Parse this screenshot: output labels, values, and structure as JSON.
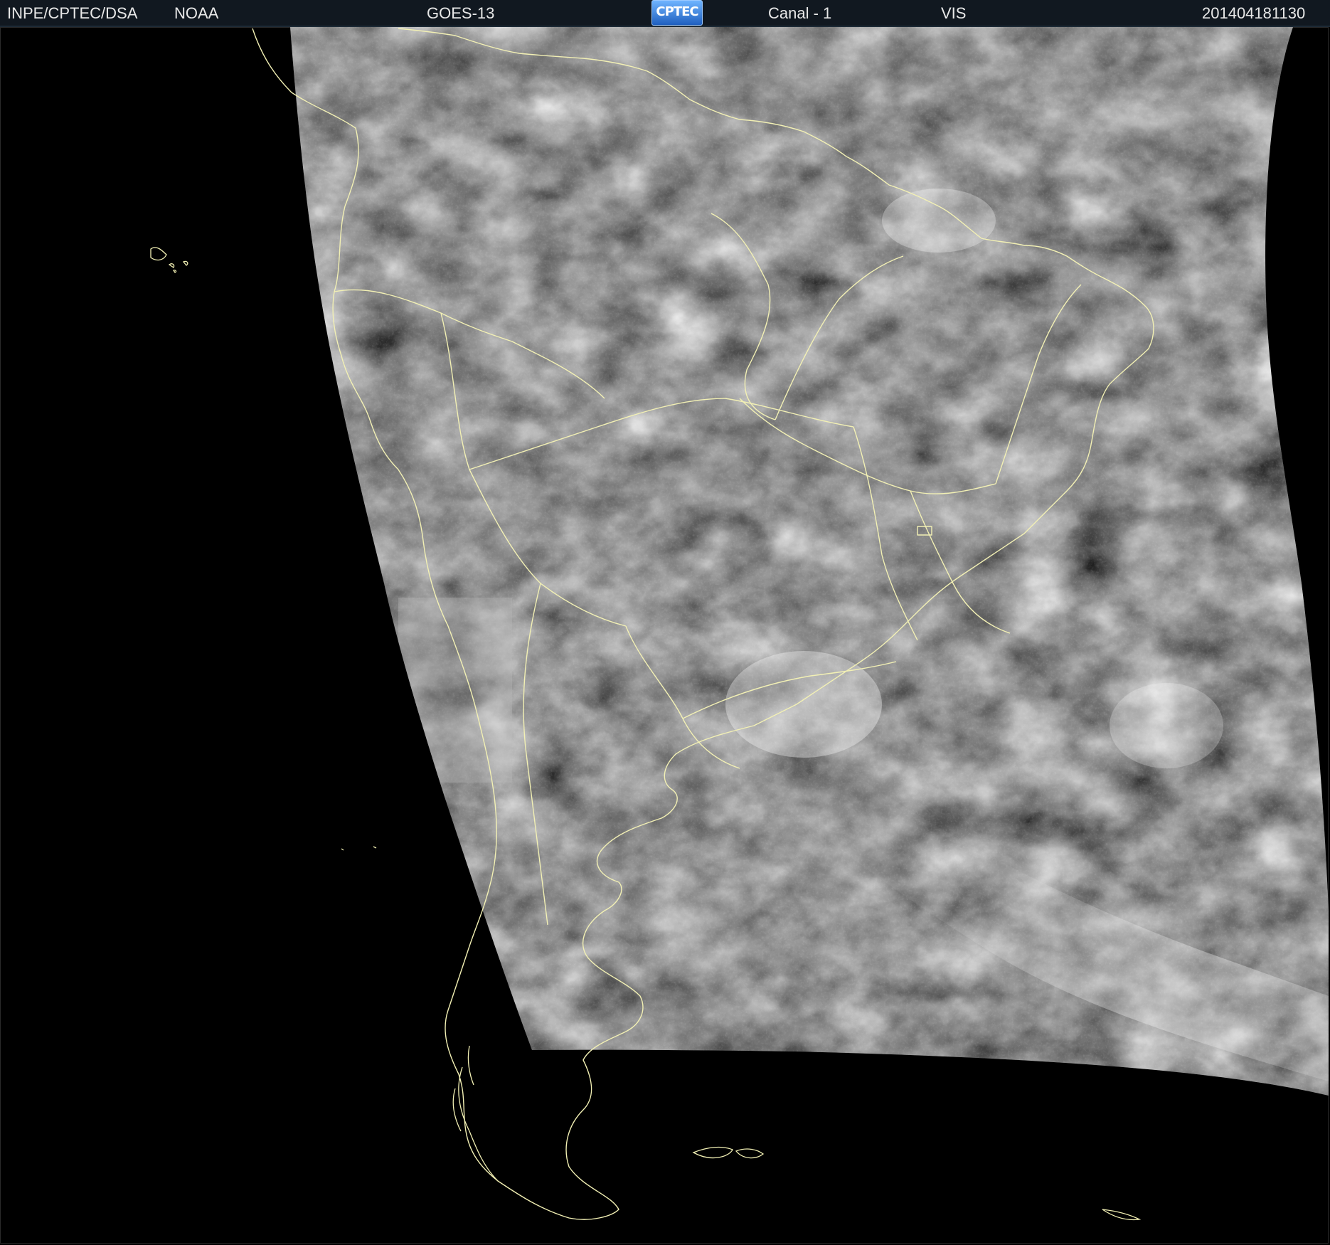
{
  "header": {
    "org": "INPE/CPTEC/DSA",
    "agency": "NOAA",
    "satellite": "GOES-13",
    "logo_text": "CPTEC",
    "channel": "Canal - 1",
    "band": "VIS",
    "timestamp": "201404181130"
  },
  "colors": {
    "background": "#000000",
    "coastline": "#f2f0b4",
    "header_bg": "#111820",
    "header_text": "#e8e8e8"
  }
}
